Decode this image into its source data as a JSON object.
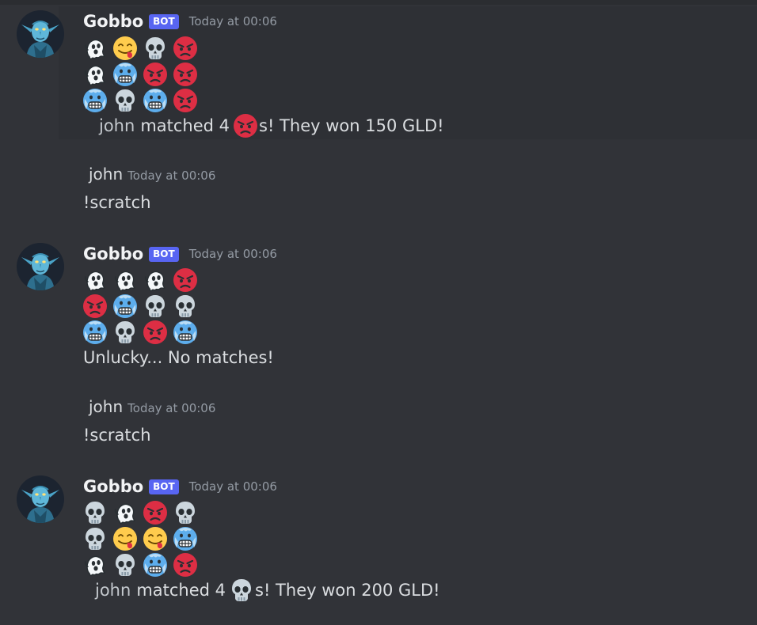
{
  "messages": [
    {
      "type": "bot",
      "author": "Gobbo",
      "tag": "BOT",
      "time": "Today at 00:06",
      "grid": [
        [
          "ghost",
          "yum",
          "skull",
          "angry"
        ],
        [
          "ghost",
          "cold",
          "angry",
          "angry"
        ],
        [
          "cold",
          "skull",
          "cold",
          "angry"
        ]
      ],
      "result": {
        "mention": "john",
        "text_before": "matched 4",
        "emoji": "angry",
        "text_after": "s! They won 150 GLD!"
      }
    },
    {
      "type": "user",
      "author": "john",
      "time": "Today at 00:06",
      "content": "!scratch"
    },
    {
      "type": "bot",
      "author": "Gobbo",
      "tag": "BOT",
      "time": "Today at 00:06",
      "grid": [
        [
          "ghost",
          "ghost",
          "ghost",
          "angry"
        ],
        [
          "angry",
          "cold",
          "skull",
          "skull"
        ],
        [
          "cold",
          "skull",
          "angry",
          "cold"
        ]
      ],
      "result_text": "Unlucky... No matches!"
    },
    {
      "type": "user",
      "author": "john",
      "time": "Today at 00:06",
      "content": "!scratch"
    },
    {
      "type": "bot",
      "author": "Gobbo",
      "tag": "BOT",
      "time": "Today at 00:06",
      "grid": [
        [
          "skull",
          "ghost",
          "angry",
          "skull"
        ],
        [
          "skull",
          "yum",
          "yum",
          "cold"
        ],
        [
          "ghost",
          "skull",
          "cold",
          "angry"
        ]
      ],
      "result": {
        "mention": "john",
        "text_before": "matched 4",
        "emoji": "skull",
        "text_after": "s! They won 200 GLD!"
      }
    }
  ],
  "icons": {
    "ghost": "ghost-emoji",
    "yum": "face-savoring-food-emoji",
    "skull": "skull-emoji",
    "angry": "angry-face-emoji",
    "cold": "cold-face-emoji"
  },
  "colors": {
    "background": "#313338",
    "highlight": "#2e3035",
    "bot_tag": "#5865f2",
    "timestamp": "#949ba4",
    "text": "#dbdee1"
  }
}
